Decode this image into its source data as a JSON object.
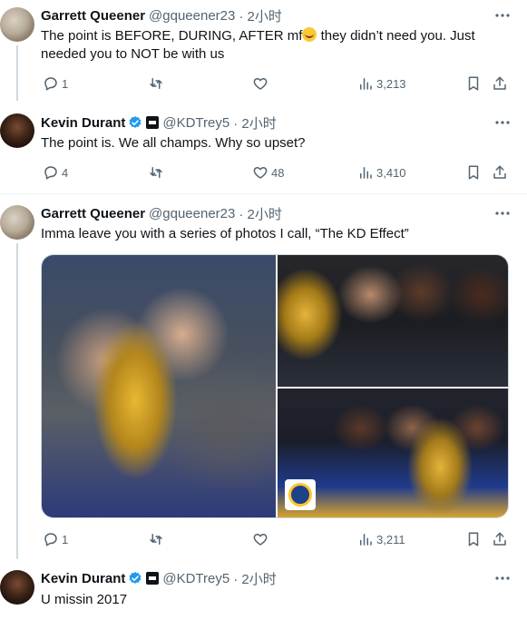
{
  "colors": {
    "text": "#0f1419",
    "secondary": "#536471",
    "verified": "#1d9bf0",
    "divider": "#eff3f4",
    "thread": "#cfd9de"
  },
  "tweets": [
    {
      "name": "Garrett Queener",
      "handle": "@gqueener23",
      "time": "· 2小时",
      "text_before_emoji": "The point is BEFORE, DURING, AFTER mf",
      "emoji": "face-with-tears-of-joy",
      "text_after_emoji": " they didn’t need you. Just needed you to NOT be with us",
      "stats": {
        "replies": "1",
        "retweets": "",
        "likes": "",
        "views": "3,213"
      }
    },
    {
      "name": "Kevin Durant",
      "handle": "@KDTrey5",
      "time": "· 2小时",
      "text": "The point is. We all champs. Why so upset?",
      "stats": {
        "replies": "4",
        "retweets": "",
        "likes": "48",
        "views": "3,410"
      }
    },
    {
      "name": "Garrett Queener",
      "handle": "@gqueener23",
      "time": "· 2小时",
      "text": "Imma leave you with a series of photos I call, “The KD Effect”",
      "media": [
        "championship-celebration-photo",
        "championship-trophy-photo",
        "championship-team-photo"
      ],
      "stats": {
        "replies": "1",
        "retweets": "",
        "likes": "",
        "views": "3,211"
      }
    },
    {
      "name": "Kevin Durant",
      "handle": "@KDTrey5",
      "time": "· 2小时",
      "text": "U missin 2017"
    }
  ]
}
